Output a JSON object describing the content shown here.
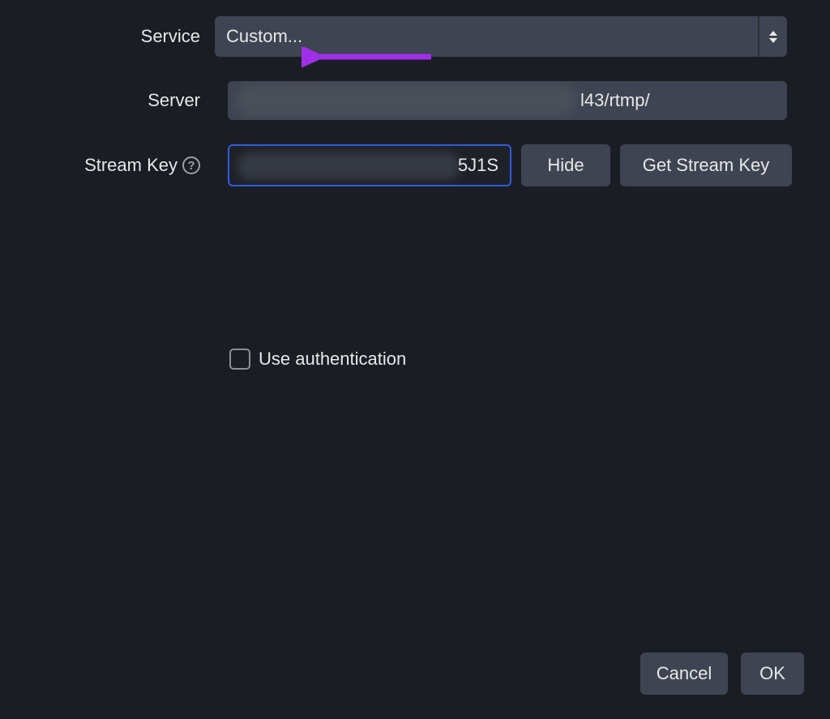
{
  "labels": {
    "service": "Service",
    "server": "Server",
    "stream_key": "Stream Key"
  },
  "service_dropdown": {
    "selected": "Custom..."
  },
  "server_input": {
    "visible_tail": "l43/rtmp/"
  },
  "stream_key_input": {
    "visible_tail": "5J1S"
  },
  "buttons": {
    "hide": "Hide",
    "get_stream_key": "Get Stream Key",
    "cancel": "Cancel",
    "ok": "OK"
  },
  "checkbox": {
    "use_authentication": "Use authentication",
    "checked": false
  },
  "helper_icon_text": "?"
}
